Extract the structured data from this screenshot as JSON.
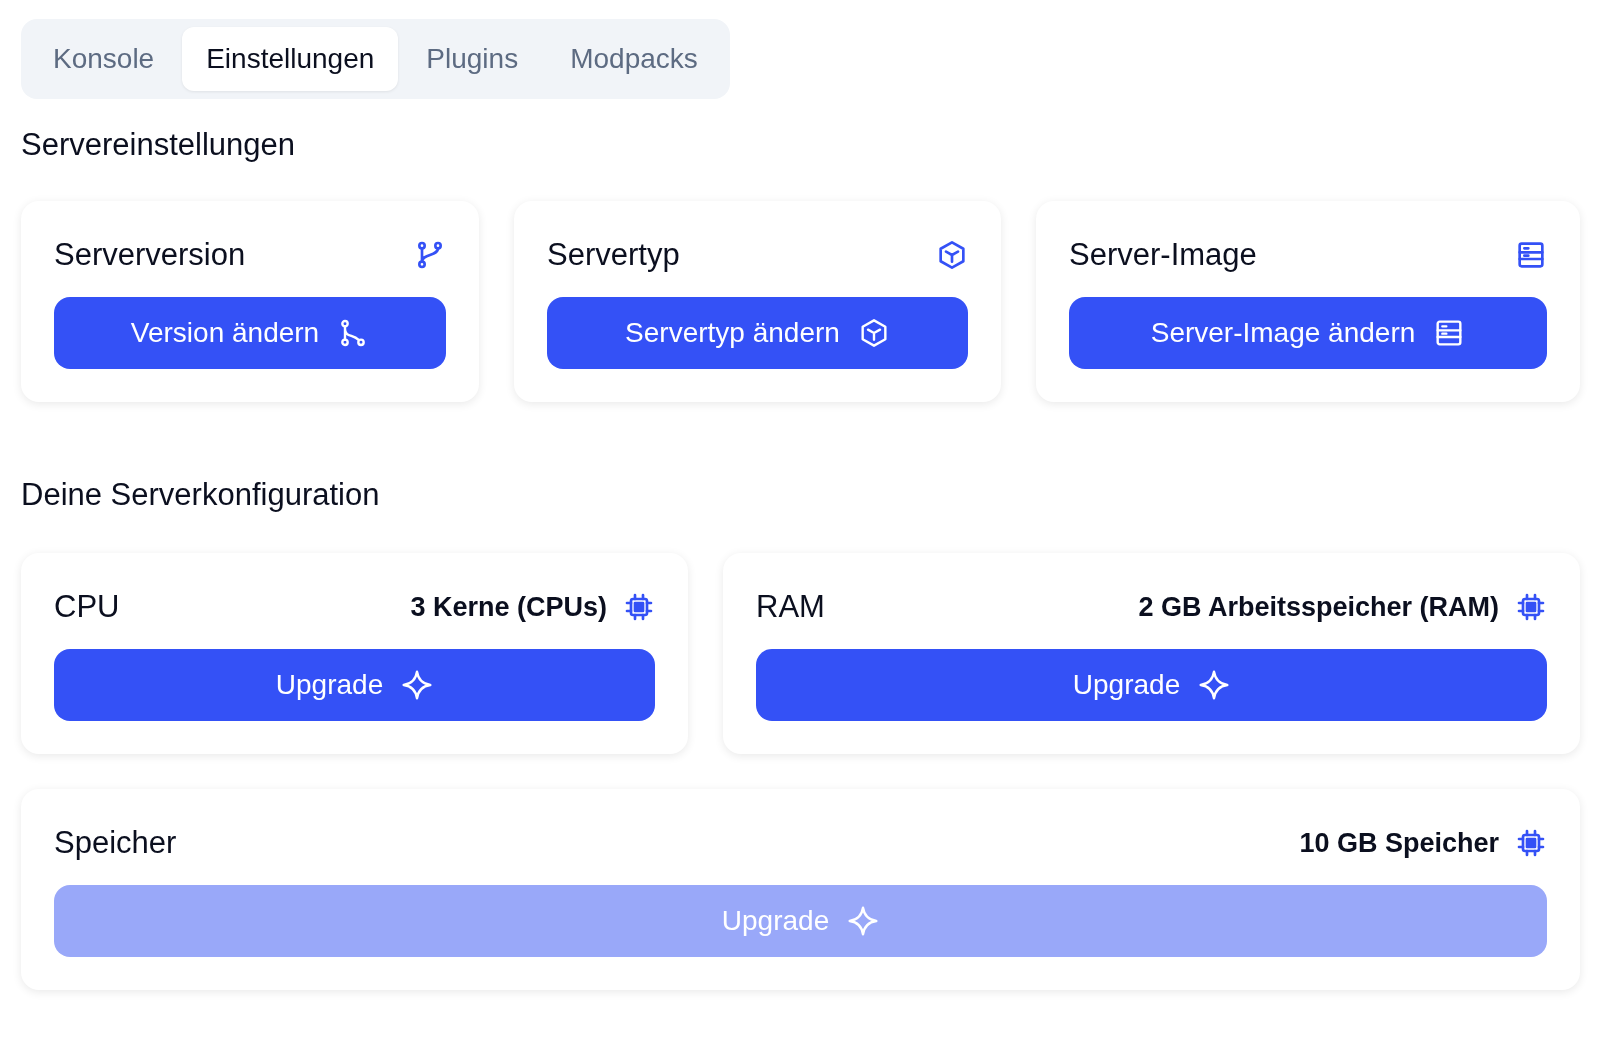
{
  "tabs": [
    {
      "label": "Konsole",
      "selected": false
    },
    {
      "label": "Einstellungen",
      "selected": true
    },
    {
      "label": "Plugins",
      "selected": false
    },
    {
      "label": "Modpacks",
      "selected": false
    }
  ],
  "server_settings": {
    "heading": "Servereinstellungen",
    "cards": [
      {
        "title": "Serverversion",
        "kind": "version",
        "button": "Version ändern"
      },
      {
        "title": "Servertyp",
        "kind": "type",
        "button": "Servertyp ändern"
      },
      {
        "title": "Server-Image",
        "kind": "image",
        "button": "Server-Image ändern"
      }
    ]
  },
  "server_configuration": {
    "heading": "Deine Serverkonfiguration",
    "cards": [
      {
        "title": "CPU",
        "value": "3 Kerne (CPUs)",
        "button": "Upgrade",
        "disabled": false
      },
      {
        "title": "RAM",
        "value": "2 GB Arbeitsspeicher (RAM)",
        "button": "Upgrade",
        "disabled": false
      },
      {
        "title": "Speicher",
        "value": "10 GB Speicher",
        "button": "Upgrade",
        "disabled": true
      }
    ]
  }
}
